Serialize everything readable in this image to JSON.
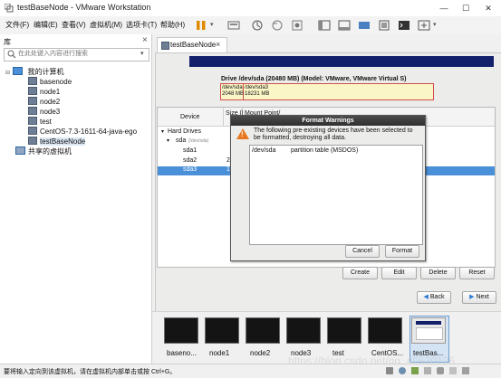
{
  "window": {
    "title": "testBaseNode - VMware Workstation",
    "minimize": "—",
    "maximize": "☐",
    "close": "✕"
  },
  "menu": [
    "文件(F)",
    "编辑(E)",
    "查看(V)",
    "虚拟机(M)",
    "选项卡(T)",
    "帮助(H)"
  ],
  "library": {
    "header": "库",
    "close": "×",
    "search_placeholder": "在此处键入内容进行搜索",
    "root": "我的计算机",
    "items": [
      "basenode",
      "node1",
      "node2",
      "node3",
      "test",
      "CentOS-7.3-1611-64-java-ego",
      "testBaseNode"
    ],
    "shared": "共享的虚拟机"
  },
  "tab": {
    "label": "testBaseNode",
    "close": "×"
  },
  "installer": {
    "drive_title": "Drive /dev/sda (20480 MB) (Model: VMware, VMware Virtual S)",
    "seg1_name": "/dev/sda",
    "seg1_size": "2048 MB",
    "seg2_name": "/dev/sda3",
    "seg2_size": "18231 MB",
    "columns": {
      "device": "Device",
      "size": "Size (M",
      "mount": "Mount Point/"
    },
    "rows": {
      "hard_drives": "Hard Drives",
      "sda": "sda",
      "sda_sub": "(/dev/sda)",
      "sda1": "sda1",
      "sda2": "sda2",
      "sda2_size": "20",
      "sda3": "sda3",
      "sda3_size": "18"
    },
    "buttons": {
      "create": "Create",
      "edit": "Edit",
      "delete": "Delete",
      "reset": "Reset"
    },
    "nav": {
      "back": "Back",
      "next": "Next"
    }
  },
  "dialog": {
    "title": "Format Warnings",
    "message": "The following pre-existing devices have been selected to be formatted, destroying all data.",
    "device": "/dev/sda",
    "detail": "partition table (MSDOS)",
    "cancel": "Cancel",
    "format": "Format"
  },
  "thumbnails": [
    "baseno...",
    "node1",
    "node2",
    "node3",
    "test",
    "CentOS...",
    "testBas..."
  ],
  "status": "要将输入定向到该虚拟机，请在虚拟机内部单击或按 Ctrl+G。",
  "watermark": "https://blog.csdn.net/qq_40530126",
  "colors": {
    "selection": "#4a90d9",
    "installer_banner": "#12206b",
    "warning": "#e8761c",
    "partition_border": "#d14d4d"
  }
}
